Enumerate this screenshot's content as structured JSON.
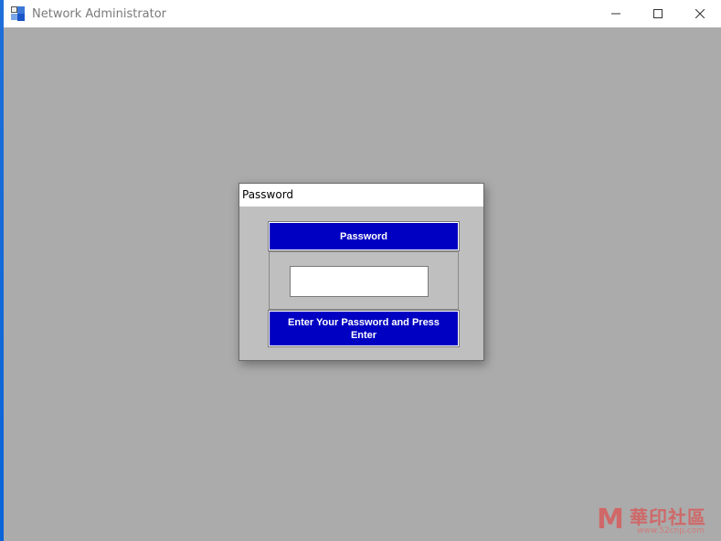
{
  "window": {
    "title": "Network Administrator",
    "icon": "app-logo-icon",
    "controls": {
      "minimize": "minimize-icon",
      "maximize": "maximize-icon",
      "close": "close-icon"
    }
  },
  "dialog": {
    "title": "Password",
    "header_label": "Password",
    "input": {
      "value": "",
      "placeholder": ""
    },
    "footer_label": "Enter Your Password and Press Enter"
  },
  "watermark": {
    "logo_glyph": "M",
    "text": "華印社區",
    "url": "www.52cnp.com"
  },
  "colors": {
    "client_bg": "#ababab",
    "dialog_bg": "#bfbfbf",
    "panel_blue": "#0000c2",
    "title_text": "#7a7a7a"
  }
}
